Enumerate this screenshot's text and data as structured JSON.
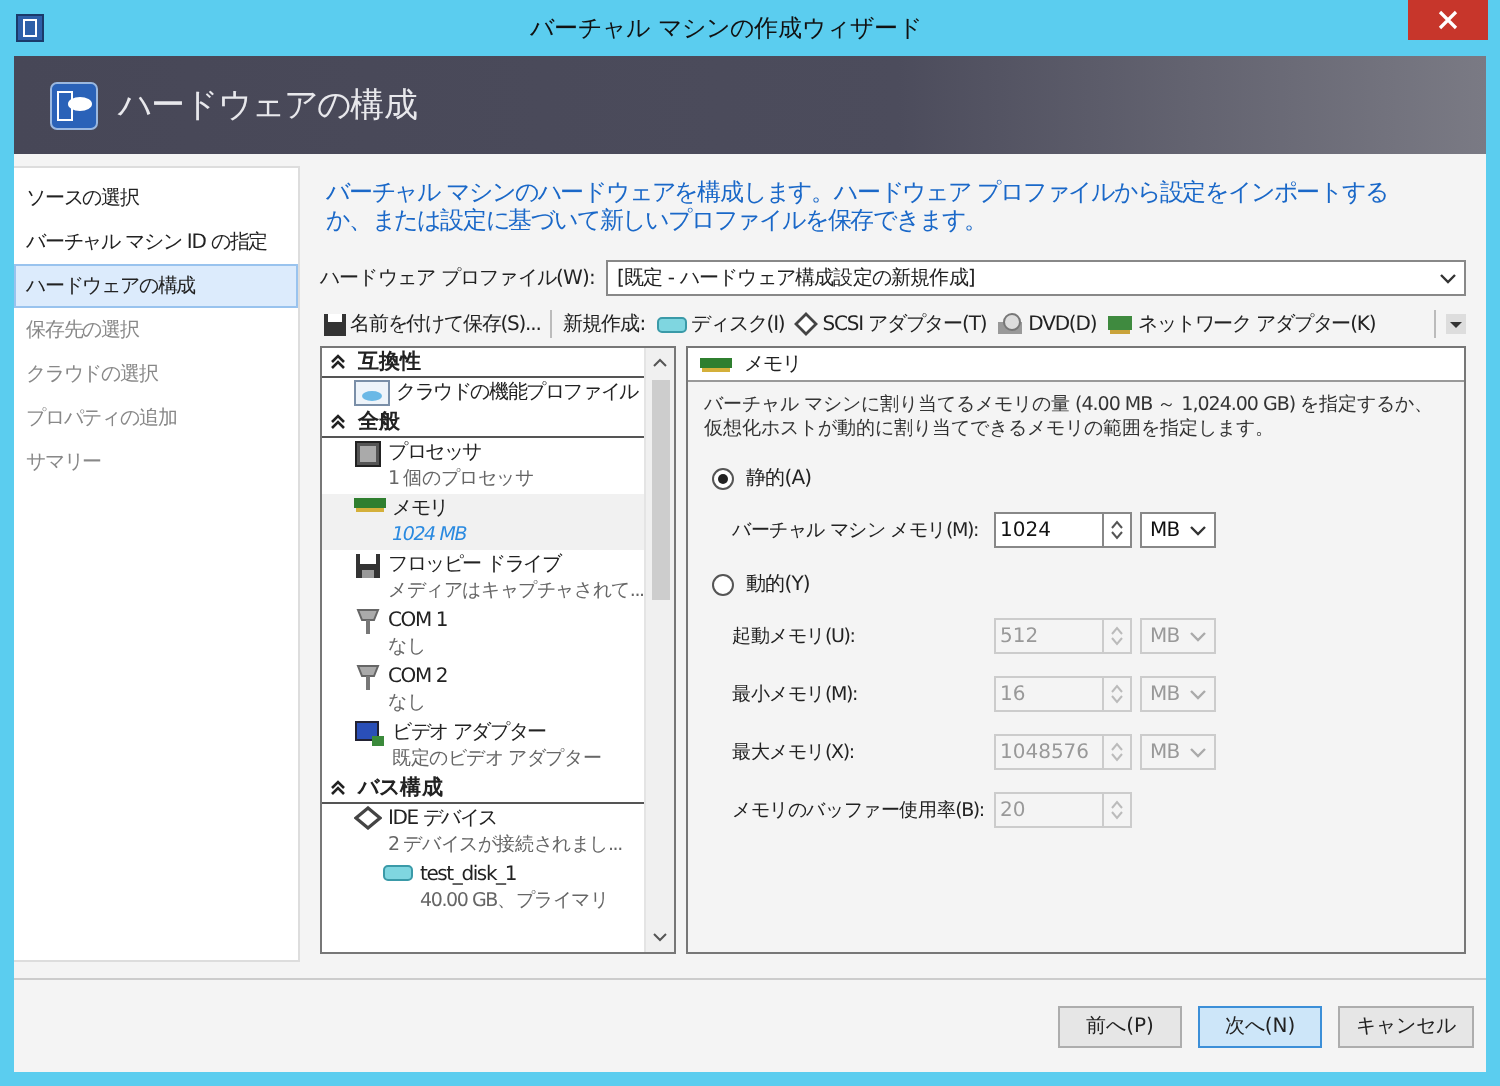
{
  "window": {
    "title": "バーチャル マシンの作成ウィザード"
  },
  "header": {
    "title": "ハードウェアの構成"
  },
  "steps": [
    {
      "label": "ソースの選択",
      "selected": false,
      "disabled": false
    },
    {
      "label": "バーチャル マシン ID の指定",
      "selected": false,
      "disabled": false
    },
    {
      "label": "ハードウェアの構成",
      "selected": true,
      "disabled": false
    },
    {
      "label": "保存先の選択",
      "selected": false,
      "disabled": true
    },
    {
      "label": "クラウドの選択",
      "selected": false,
      "disabled": true
    },
    {
      "label": "プロパティの追加",
      "selected": false,
      "disabled": true
    },
    {
      "label": "サマリー",
      "selected": false,
      "disabled": true
    }
  ],
  "intro": "バーチャル マシンのハードウェアを構成します。ハードウェア プロファイルから設定をインポートするか、または設定に基づいて新しいプロファイルを保存できます。",
  "profile": {
    "label": "ハードウェア プロファイル(W):",
    "value": "[既定 - ハードウェア構成設定の新規作成]"
  },
  "toolbar": {
    "save": "名前を付けて保存(S)...",
    "new_label": "新規作成:",
    "items": [
      {
        "kind": "disk",
        "label": "ディスク(I)"
      },
      {
        "kind": "scsi",
        "label": "SCSI アダプター(T)"
      },
      {
        "kind": "dvd",
        "label": "DVD(D)"
      },
      {
        "kind": "network",
        "label": "ネットワーク アダプター(K)"
      }
    ]
  },
  "tree": {
    "sections": [
      {
        "title": "互換性",
        "items": [
          {
            "kind": "cloud",
            "name": "クラウドの機能プロファイル",
            "selected": false
          }
        ]
      },
      {
        "title": "全般",
        "items": [
          {
            "kind": "cpu",
            "name": "プロセッサ",
            "detail": "1 個のプロセッサ",
            "selected": false
          },
          {
            "kind": "memory",
            "name": "メモリ",
            "detail": "1024 MB",
            "selected": true
          },
          {
            "kind": "floppy",
            "name": "フロッピー ドライブ",
            "detail": "メディアはキャプチャされて...",
            "selected": false
          },
          {
            "kind": "port",
            "name": "COM 1",
            "detail": "なし",
            "selected": false
          },
          {
            "kind": "port",
            "name": "COM 2",
            "detail": "なし",
            "selected": false
          },
          {
            "kind": "video",
            "name": "ビデオ アダプター",
            "detail": "既定のビデオ アダプター",
            "selected": false
          }
        ]
      },
      {
        "title": "バス構成",
        "items": [
          {
            "kind": "ide",
            "name": "IDE デバイス",
            "detail": "2 デバイスが接続されまし...",
            "selected": false,
            "children": [
              {
                "kind": "disk",
                "name": "test_disk_1",
                "detail": "40.00 GB、プライマリ",
                "selected": false
              }
            ]
          }
        ]
      }
    ]
  },
  "detail": {
    "title": "メモリ",
    "description": "バーチャル マシンに割り当てるメモリの量 (4.00 MB ～ 1,024.00 GB) を指定するか、仮想化ホストが動的に割り当てできるメモリの範囲を指定します。",
    "options": [
      {
        "label": "静的(A)",
        "selected": true,
        "fields": [
          {
            "label": "バーチャル マシン メモリ(M):",
            "value": "1024",
            "unit": "MB"
          }
        ]
      },
      {
        "label": "動的(Y)",
        "selected": false,
        "fields": [
          {
            "label": "起動メモリ(U):",
            "value": "512",
            "unit": "MB"
          },
          {
            "label": "最小メモリ(M):",
            "value": "16",
            "unit": "MB"
          },
          {
            "label": "最大メモリ(X):",
            "value": "1048576",
            "unit": "MB"
          },
          {
            "label": "メモリのバッファー使用率(B):",
            "value": "20"
          }
        ]
      }
    ]
  },
  "buttons": [
    {
      "label": "前へ(P)",
      "highlighted": false
    },
    {
      "label": "次へ(N)",
      "highlighted": true
    },
    {
      "label": "キャンセル",
      "highlighted": false
    }
  ]
}
